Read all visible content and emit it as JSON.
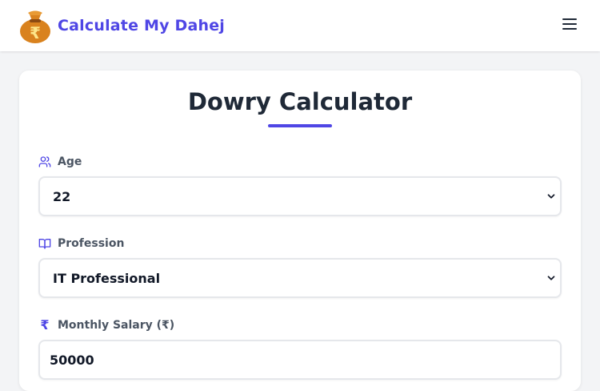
{
  "header": {
    "brand_title": "Calculate My Dahej",
    "logo_icon": "money-bag-rupee-icon",
    "menu_icon": "hamburger-menu-icon"
  },
  "calculator": {
    "title": "Dowry Calculator",
    "age": {
      "label": "Age",
      "icon": "users-icon",
      "value": "22"
    },
    "profession": {
      "label": "Profession",
      "icon": "open-book-icon",
      "value": "IT Professional"
    },
    "salary": {
      "label": "Monthly Salary (₹)",
      "icon": "rupee-icon",
      "value": "50000"
    }
  },
  "colors": {
    "accent": "#4f46e5",
    "text_dark": "#1f2937",
    "label": "#4b5563",
    "border": "#e5e7eb",
    "background": "#f3f4f6"
  }
}
